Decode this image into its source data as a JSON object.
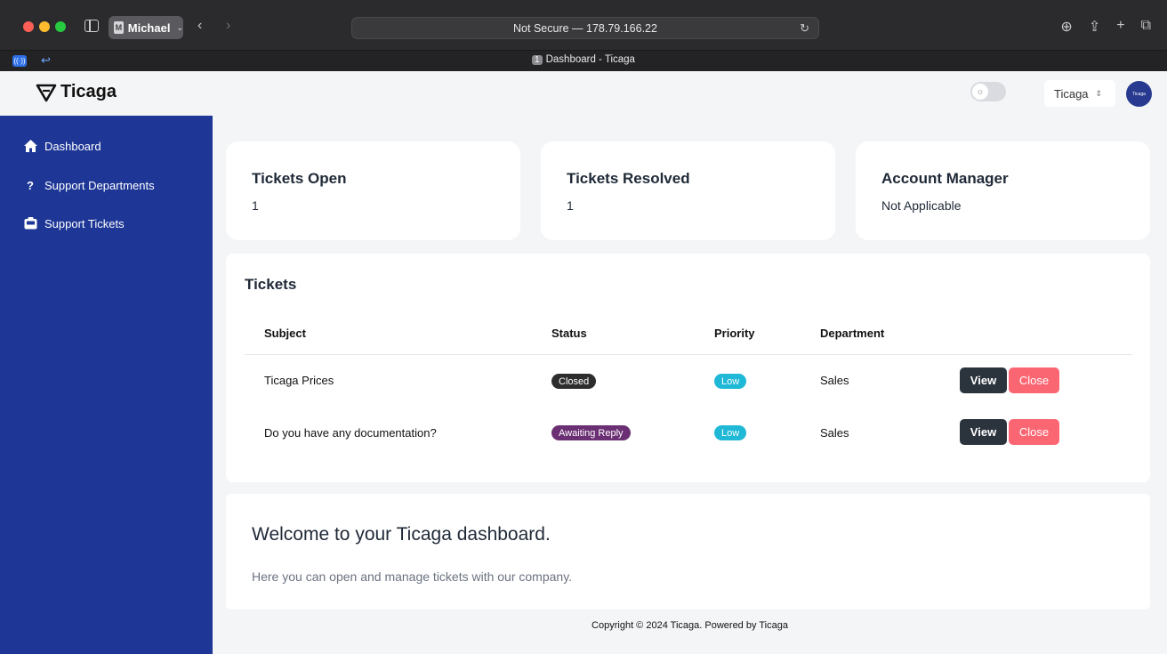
{
  "browser": {
    "profile_badge": "M",
    "profile_name": "Michael",
    "url": "Not Secure — 178.79.166.22",
    "tab_number": "1",
    "tab_title": "Dashboard - Ticaga"
  },
  "header": {
    "logo_text": "Ticaga",
    "org_select": "Ticaga",
    "avatar_text": "Ticaga"
  },
  "sidebar": {
    "items": [
      {
        "label": "Dashboard",
        "icon": "home-icon"
      },
      {
        "label": "Support Departments",
        "icon": "question-icon"
      },
      {
        "label": "Support Tickets",
        "icon": "inbox-icon"
      }
    ]
  },
  "stats": [
    {
      "title": "Tickets Open",
      "value": "1"
    },
    {
      "title": "Tickets Resolved",
      "value": "1"
    },
    {
      "title": "Account Manager",
      "value": "Not Applicable"
    }
  ],
  "tickets": {
    "title": "Tickets",
    "columns": [
      "Subject",
      "Status",
      "Priority",
      "Department"
    ],
    "rows": [
      {
        "subject": "Ticaga Prices",
        "status": "Closed",
        "priority": "Low",
        "department": "Sales",
        "view": "View",
        "close": "Close"
      },
      {
        "subject": "Do you have any documentation?",
        "status": "Awaiting Reply",
        "priority": "Low",
        "department": "Sales",
        "view": "View",
        "close": "Close"
      }
    ]
  },
  "welcome": {
    "title": "Welcome to your Ticaga dashboard.",
    "text": "Here you can open and manage tickets with our company."
  },
  "footer": "Copyright © 2024 Ticaga. Powered by Ticaga",
  "colors": {
    "sidebar": "#1e3796",
    "status_closed": "#2d2d2d",
    "status_awaiting": "#6b2f73",
    "priority_low": "#1fb8d6",
    "view_button": "#2b333d",
    "close_button": "#fb6673"
  }
}
